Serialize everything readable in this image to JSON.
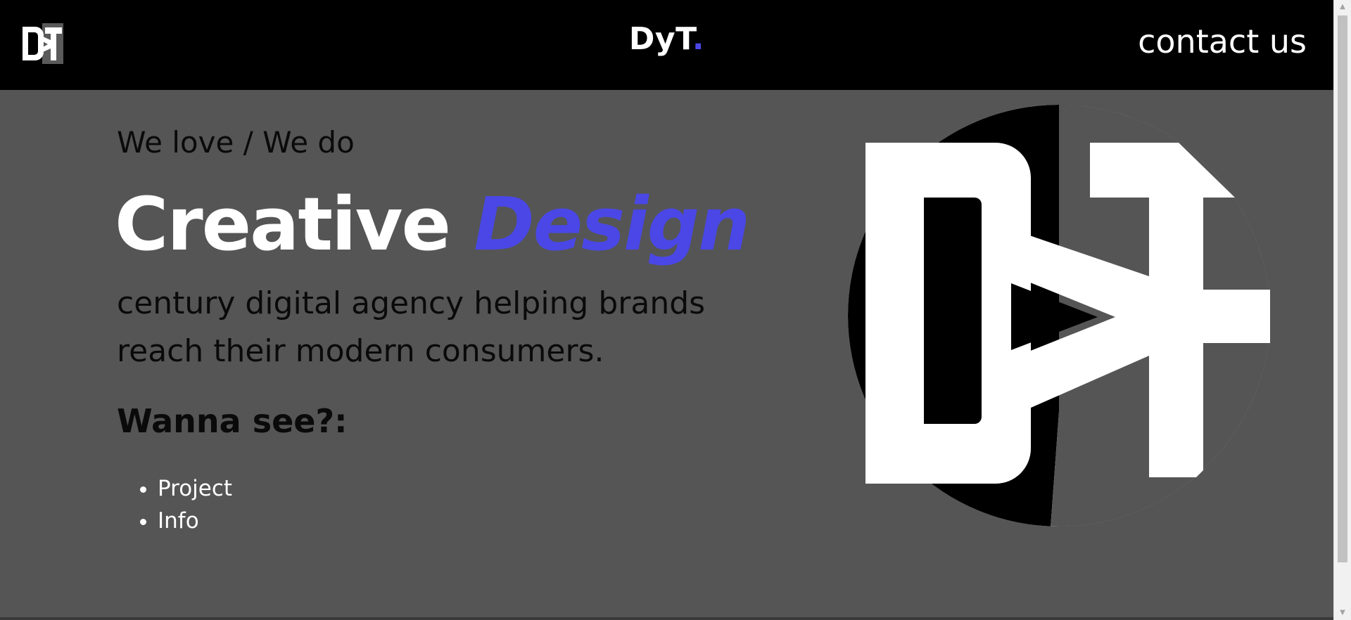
{
  "header": {
    "brand_main": "DyT",
    "brand_dot": ".",
    "contact_label": "contact us",
    "logo_icon": "dyt-monogram-icon"
  },
  "hero": {
    "tagline": "We love / We do",
    "headline_plain": "Creative",
    "headline_accent": "Design",
    "description": "century digital agency helping brands reach their modern consumers.",
    "cta": "Wanna see?:",
    "links": [
      {
        "label": "Project"
      },
      {
        "label": "Info"
      }
    ],
    "logo_icon": "dyt-circle-logo-icon"
  },
  "colors": {
    "header_bg": "#000000",
    "page_bg": "#555555",
    "accent": "#4a47e6",
    "text_dark": "#0a0a0a",
    "text_light": "#ffffff"
  }
}
